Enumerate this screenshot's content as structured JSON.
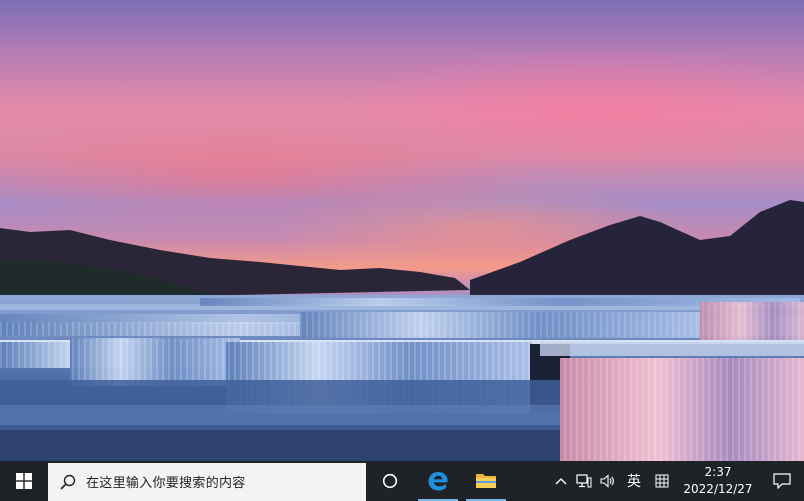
{
  "taskbar": {
    "search_placeholder": "在这里输入你要搜索的内容",
    "tray": {
      "input_language": "英",
      "clock_time": "2:37",
      "clock_date": "2022/12/27"
    },
    "accent_color": "#76b9ed"
  },
  "icons": {
    "start": "windows-logo-icon",
    "search": "search-icon",
    "cortana": "cortana-icon",
    "edge": "edge-icon",
    "file_explorer": "folder-icon",
    "tray_expand": "chevron-up-icon",
    "network": "network-icon",
    "volume": "volume-icon",
    "ime_mode": "ime-grid-icon",
    "notifications": "notification-icon"
  }
}
